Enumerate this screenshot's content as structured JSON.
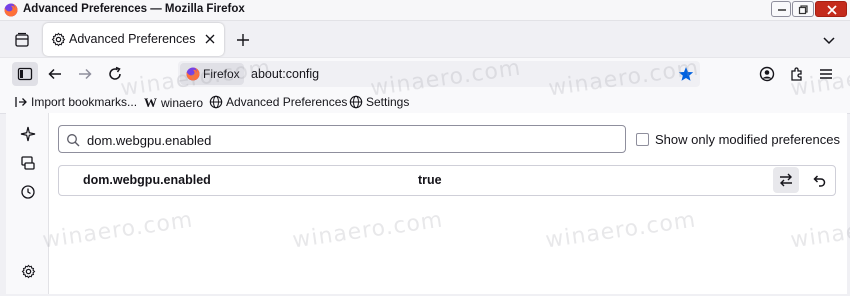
{
  "window": {
    "title": "Advanced Preferences — Mozilla Firefox"
  },
  "tabs": [
    {
      "label": "Advanced Preferences",
      "icon": "gear-icon",
      "active": true
    }
  ],
  "navbar": {
    "identity_label": "Firefox",
    "url": "about:config"
  },
  "bookmarks": [
    {
      "label": "Import bookmarks...",
      "icon": "import-icon"
    },
    {
      "label": "winaero",
      "icon": "winaero-logo"
    },
    {
      "label": "Advanced Preferences",
      "icon": "globe-icon"
    },
    {
      "label": "Settings",
      "icon": "globe-icon"
    }
  ],
  "config": {
    "search_value": "dom.webgpu.enabled",
    "show_modified_label": "Show only modified preferences",
    "show_modified_checked": false,
    "rows": [
      {
        "name": "dom.webgpu.enabled",
        "value": "true"
      }
    ]
  },
  "watermark": "winaero.com",
  "colors": {
    "accent": "#0060df",
    "bookmark_star": "#0061e0",
    "close_button": "#c42b1c"
  }
}
